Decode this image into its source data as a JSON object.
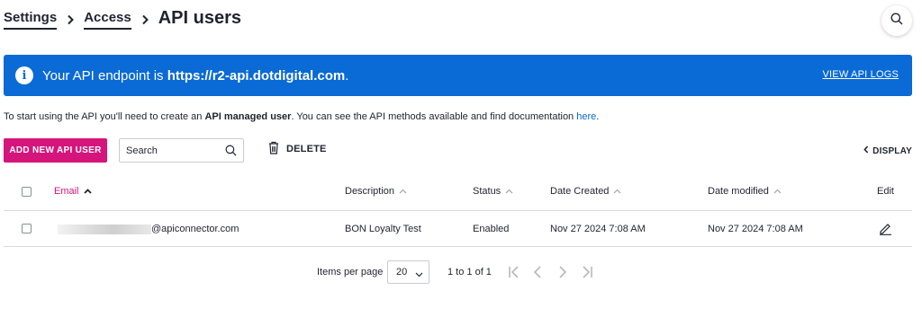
{
  "breadcrumb": {
    "items": [
      "Settings",
      "Access"
    ],
    "current": "API users"
  },
  "banner": {
    "text_prefix": "Your API endpoint is ",
    "endpoint": "https://r2-api.dotdigital.com",
    "text_suffix": ".",
    "link_label": "VIEW API LOGS",
    "color": "#0a6ad6"
  },
  "intro": {
    "part1": "To start using the API you'll need to create an ",
    "bold": "API managed user",
    "part2": ". You can see the API methods available and find documentation ",
    "link": "here",
    "part3": "."
  },
  "toolbar": {
    "add_label": "ADD NEW API USER",
    "search_placeholder": "Search",
    "delete_label": "DELETE",
    "display_label": "DISPLAY",
    "accent": "#d5147c"
  },
  "table": {
    "headers": {
      "email": "Email",
      "description": "Description",
      "status": "Status",
      "date_created": "Date Created",
      "date_modified": "Date modified",
      "edit": "Edit"
    },
    "rows": [
      {
        "email_domain": "@apiconnector.com",
        "description": "BON Loyalty Test",
        "status": "Enabled",
        "date_created": "Nov 27 2024 7:08 AM",
        "date_modified": "Nov 27 2024 7:08 AM"
      }
    ]
  },
  "pagination": {
    "items_per_page_label": "Items per page",
    "items_per_page_value": "20",
    "range": "1 to 1 of 1"
  }
}
